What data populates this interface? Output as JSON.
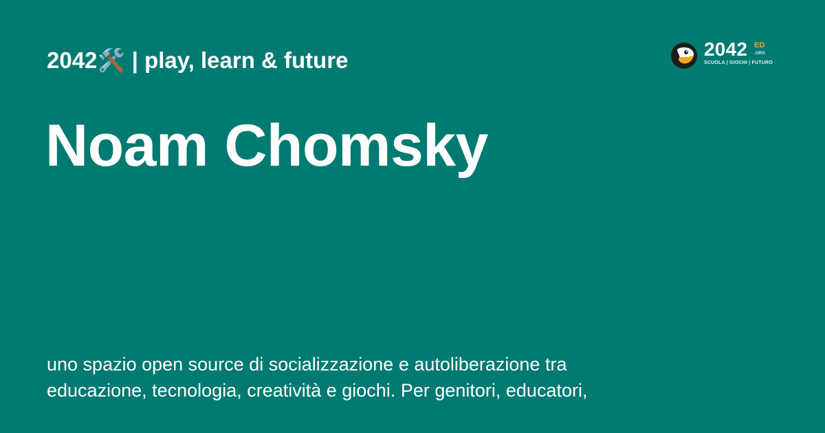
{
  "header": {
    "tagline": "2042🛠️ | play, learn & future"
  },
  "main": {
    "title": "Noam Chomsky",
    "description": "uno spazio open source di socializzazione e autoliberazione tra educazione, tecnologia, creatività e giochi. Per genitori, educatori,"
  },
  "logo": {
    "number": "2042",
    "suffix": "ED",
    "domain": ".ORG",
    "subtitle": "SCUOLA | GIOCHI | FUTURO",
    "icon": "mascot-icon",
    "colors": {
      "background": "#017a72",
      "accent": "#f5a623",
      "mark_dark": "#1d1d1b"
    }
  }
}
